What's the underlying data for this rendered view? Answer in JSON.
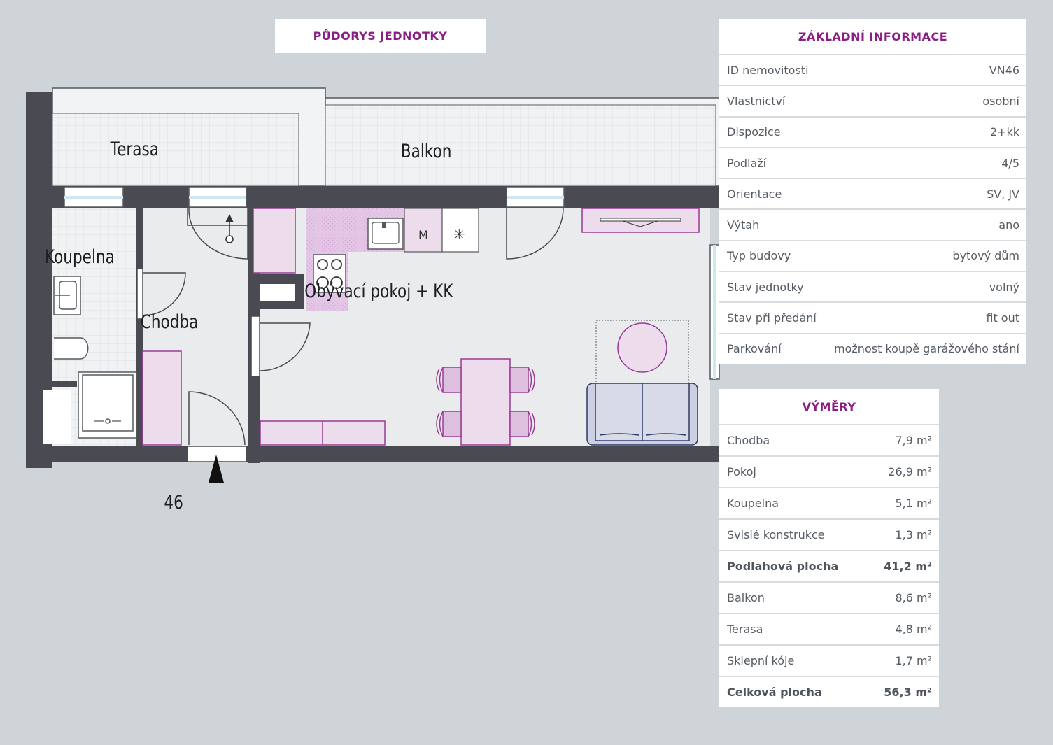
{
  "floorplan": {
    "title": "PŮDORYS JEDNOTKY",
    "rooms": {
      "terrace": "Terasa",
      "balcony": "Balkon",
      "bathroom": "Koupelna",
      "hallway": "Chodba",
      "living": "Obývací pokoj + KK"
    },
    "unit_number": "46",
    "microwave_symbol": "M",
    "fridge_symbol": "✳",
    "colors": {
      "wall": "#4a4a52",
      "accent": "#8b1e86",
      "furniture": "#ecdcec",
      "floor": "#e9ebed"
    }
  },
  "basic_info": {
    "title": "ZÁKLADNÍ INFORMACE",
    "rows": [
      {
        "label": "ID nemovitosti",
        "value": "VN46"
      },
      {
        "label": "Vlastnictví",
        "value": "osobní"
      },
      {
        "label": "Dispozice",
        "value": "2+kk"
      },
      {
        "label": "Podlaží",
        "value": "4/5"
      },
      {
        "label": "Orientace",
        "value": "SV, JV"
      },
      {
        "label": "Výtah",
        "value": "ano"
      },
      {
        "label": "Typ budovy",
        "value": "bytový dům"
      },
      {
        "label": "Stav jednotky",
        "value": "volný"
      },
      {
        "label": "Stav při předání",
        "value": "fit out"
      },
      {
        "label": "Parkování",
        "value": "možnost koupě garážového stání"
      }
    ]
  },
  "areas": {
    "title": "VÝMĚRY",
    "rows": [
      {
        "label": "Chodba",
        "value": "7,9 m²"
      },
      {
        "label": "Pokoj",
        "value": "26,9 m²"
      },
      {
        "label": "Koupelna",
        "value": "5,1 m²"
      },
      {
        "label": "Svislé konstrukce",
        "value": "1,3 m²"
      },
      {
        "label": "Podlahová plocha",
        "value": "41,2 m²",
        "bold": true
      },
      {
        "label": "Balkon",
        "value": "8,6 m²"
      },
      {
        "label": "Terasa",
        "value": "4,8 m²"
      },
      {
        "label": "Sklepní kóje",
        "value": "1,7 m²"
      },
      {
        "label": "Celková plocha",
        "value": "56,3 m²",
        "bold": true
      }
    ]
  }
}
